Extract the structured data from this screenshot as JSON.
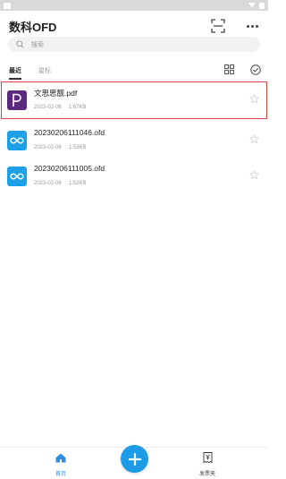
{
  "app": {
    "title": "数科OFD"
  },
  "search": {
    "placeholder": "搜索"
  },
  "tabs": [
    {
      "label": "最近",
      "active": true
    },
    {
      "label": "星标",
      "active": false
    }
  ],
  "files": [
    {
      "name": "文思思靓.pdf",
      "date": "2023-02-06",
      "size": "1.67KB",
      "type": "pdf",
      "icon_letter": "P",
      "selected": true
    },
    {
      "name": "20230206111046.ofd",
      "date": "2023-02-06",
      "size": "1.53KB",
      "type": "ofd",
      "selected": false
    },
    {
      "name": "20230206111005.ofd",
      "date": "2023-02-06",
      "size": "1.52KB",
      "type": "ofd",
      "selected": false
    }
  ],
  "bottom_nav": {
    "home_label": "首页",
    "invoice_label": "发票夹"
  },
  "colors": {
    "accent": "#1e9be6",
    "pdf_icon": "#5b2a7e",
    "ofd_icon": "#1ea0e6",
    "selection_outline": "#d9463b"
  },
  "icons": {
    "scan": "scan-icon",
    "more": "more-icon",
    "search": "search-icon",
    "grid": "grid-view-icon",
    "select": "check-circle-icon",
    "star": "star-outline-icon",
    "home": "home-icon",
    "add": "plus-icon",
    "invoice": "invoice-icon"
  }
}
